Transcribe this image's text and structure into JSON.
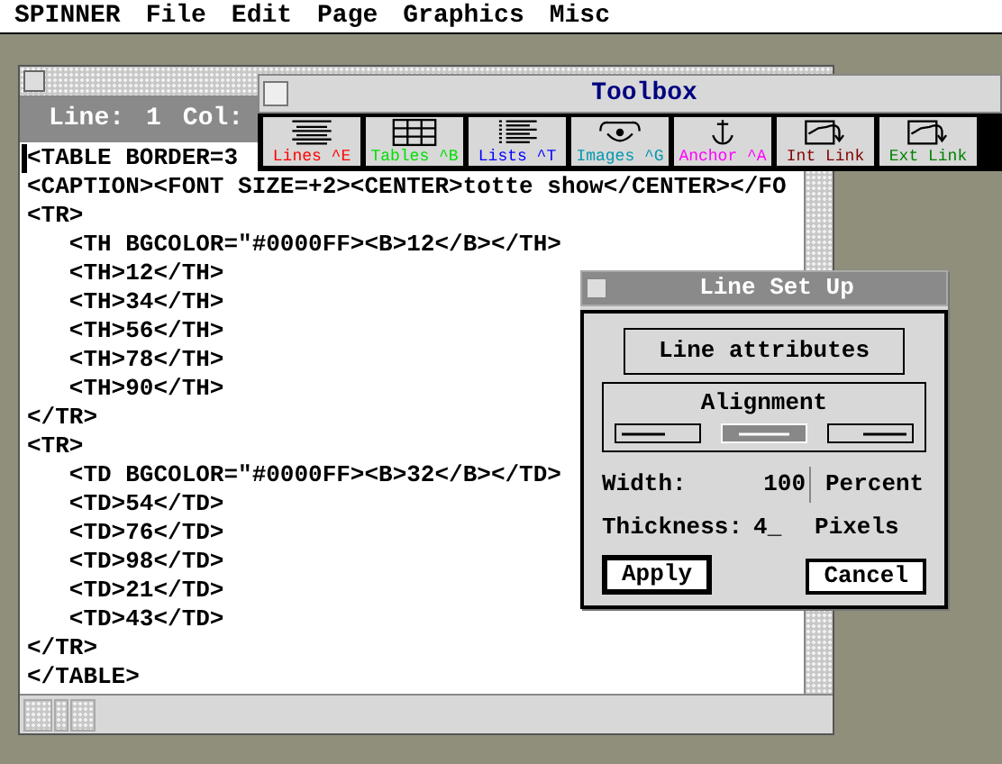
{
  "menu_bar": [
    "SPINNER",
    "File",
    "Edit",
    "Page",
    "Graphics",
    "Misc"
  ],
  "editor": {
    "status": {
      "line_label": "Line:",
      "line": "1",
      "col_label": "Col:"
    },
    "lines": [
      {
        "text": "<TABLE BORDER=3",
        "cursor": true
      },
      {
        "text": "<CAPTION><FONT SIZE=+2><CENTER>totte show</CENTER></FO",
        "cursor": false
      },
      {
        "text": "<TR>",
        "cursor": false
      },
      {
        "text": "   <TH BGCOLOR=\"#0000FF><B>12</B></TH>",
        "cursor": false
      },
      {
        "text": "   <TH>12</TH>",
        "cursor": false
      },
      {
        "text": "   <TH>34</TH>",
        "cursor": false
      },
      {
        "text": "   <TH>56</TH>",
        "cursor": false
      },
      {
        "text": "   <TH>78</TH>",
        "cursor": false
      },
      {
        "text": "   <TH>90</TH>",
        "cursor": false
      },
      {
        "text": "</TR>",
        "cursor": false
      },
      {
        "text": "<TR>",
        "cursor": false
      },
      {
        "text": "   <TD BGCOLOR=\"#0000FF><B>32</B></TD>",
        "cursor": false
      },
      {
        "text": "   <TD>54</TD>",
        "cursor": false
      },
      {
        "text": "   <TD>76</TD>",
        "cursor": false
      },
      {
        "text": "   <TD>98</TD>",
        "cursor": false
      },
      {
        "text": "   <TD>21</TD>",
        "cursor": false
      },
      {
        "text": "   <TD>43</TD>",
        "cursor": false
      },
      {
        "text": "</TR>",
        "cursor": false
      },
      {
        "text": "</TABLE>",
        "cursor": false
      }
    ]
  },
  "toolbox": {
    "title": "Toolbox",
    "tools": [
      {
        "kind": "lines",
        "label": "Lines ^E",
        "color": "#ff0000"
      },
      {
        "kind": "tables",
        "label": "Tables ^B",
        "color": "#00e000"
      },
      {
        "kind": "lists",
        "label": "Lists ^T",
        "color": "#0000ff"
      },
      {
        "kind": "images",
        "label": "Images ^G",
        "color": "#0098b0"
      },
      {
        "kind": "anchor",
        "label": "Anchor ^A",
        "color": "#ff00ff"
      },
      {
        "kind": "intlink",
        "label": "Int Link",
        "color": "#800000"
      },
      {
        "kind": "extlink",
        "label": "Ext Link",
        "color": "#008000"
      }
    ]
  },
  "dialog": {
    "title": "Line Set Up",
    "heading": "Line attributes",
    "alignment": {
      "label": "Alignment",
      "options": [
        {
          "kind": "left",
          "selected": false
        },
        {
          "kind": "center",
          "selected": true
        },
        {
          "kind": "right",
          "selected": false
        }
      ]
    },
    "width": {
      "label": "Width:",
      "value": "100",
      "unit": "Percent"
    },
    "thickness": {
      "label": "Thickness:",
      "value": "4_",
      "unit": "Pixels"
    },
    "buttons": [
      {
        "label": "Apply",
        "default": true
      },
      {
        "label": "Cancel",
        "default": false
      }
    ]
  }
}
